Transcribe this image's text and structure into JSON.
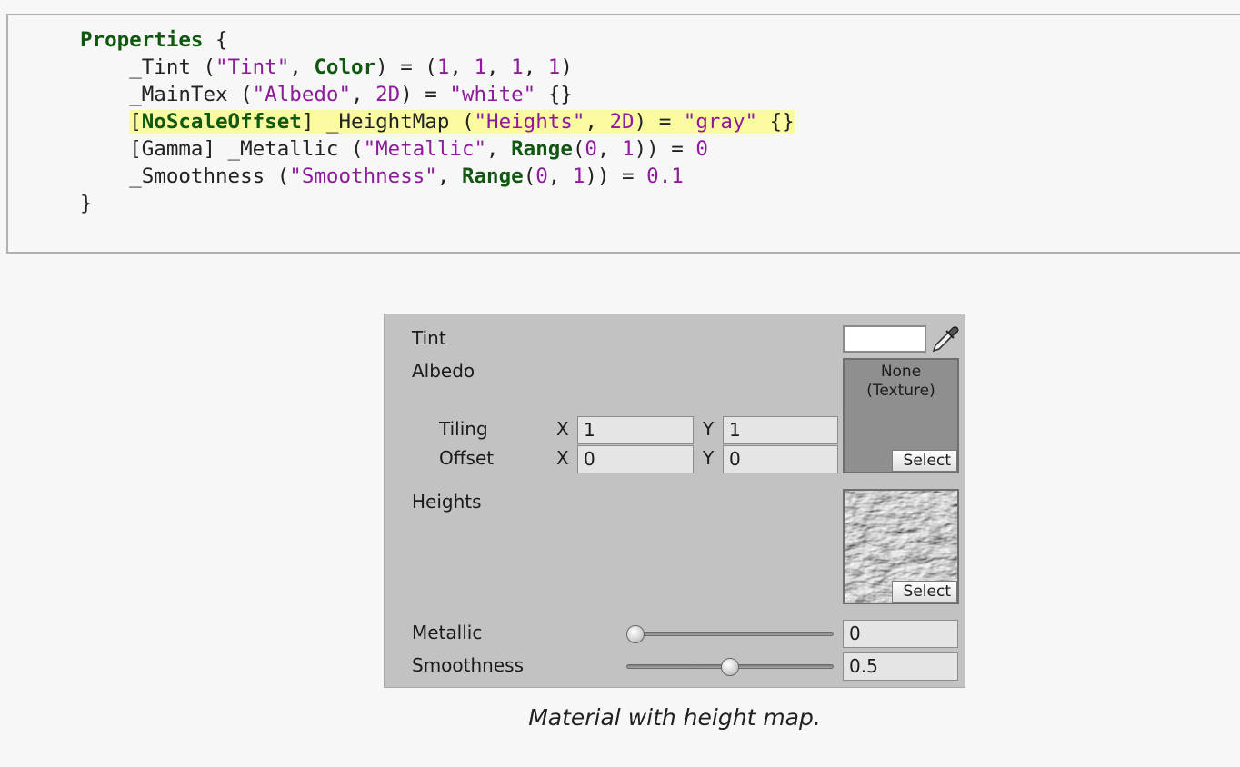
{
  "code": {
    "keyword_properties": "Properties",
    "open_brace": " {",
    "close_brace": "}",
    "line1": {
      "name": "_Tint (",
      "str": "\"Tint\"",
      "sep": ", ",
      "kw": "Color",
      "mid": ") = (",
      "n1": "1",
      "c1": ", ",
      "n2": "1",
      "c2": ", ",
      "n3": "1",
      "c3": ", ",
      "n4": "1",
      "end": ")"
    },
    "line2": {
      "name": "_MainTex (",
      "str": "\"Albedo\"",
      "sep": ", ",
      "n1": "2D",
      "mid": ") = ",
      "str2": "\"white\"",
      "end": " {}"
    },
    "line3": {
      "open": "[",
      "kw": "NoScaleOffset",
      "mid": "] _HeightMap (",
      "str": "\"Heights\"",
      "sep": ", ",
      "n1": "2D",
      "mid2": ") = ",
      "str2": "\"gray\"",
      "end": " {}"
    },
    "line4": {
      "pre": "[Gamma] _Metallic (",
      "str": "\"Metallic\"",
      "sep": ", ",
      "kw": "Range",
      "open": "(",
      "n1": "0",
      "c1": ", ",
      "n2": "1",
      "mid": ")) = ",
      "n3": "0"
    },
    "line5": {
      "pre": "_Smoothness (",
      "str": "\"Smoothness\"",
      "sep": ", ",
      "kw": "Range",
      "open": "(",
      "n1": "0",
      "c1": ", ",
      "n2": "1",
      "mid": ")) = ",
      "n3": "0.1"
    }
  },
  "inspector": {
    "tint_label": "Tint",
    "tint_color": "#ffffff",
    "albedo_label": "Albedo",
    "albedo_slot_text": "None\n(Texture)",
    "select_label": "Select",
    "tiling_label": "Tiling",
    "offset_label": "Offset",
    "x_label": "X",
    "y_label": "Y",
    "tiling_x": "1",
    "tiling_y": "1",
    "offset_x": "0",
    "offset_y": "0",
    "heights_label": "Heights",
    "metallic_label": "Metallic",
    "metallic_value": "0",
    "metallic_fraction": 0,
    "smoothness_label": "Smoothness",
    "smoothness_value": "0.5",
    "smoothness_fraction": 0.5
  },
  "caption": "Material with height map."
}
